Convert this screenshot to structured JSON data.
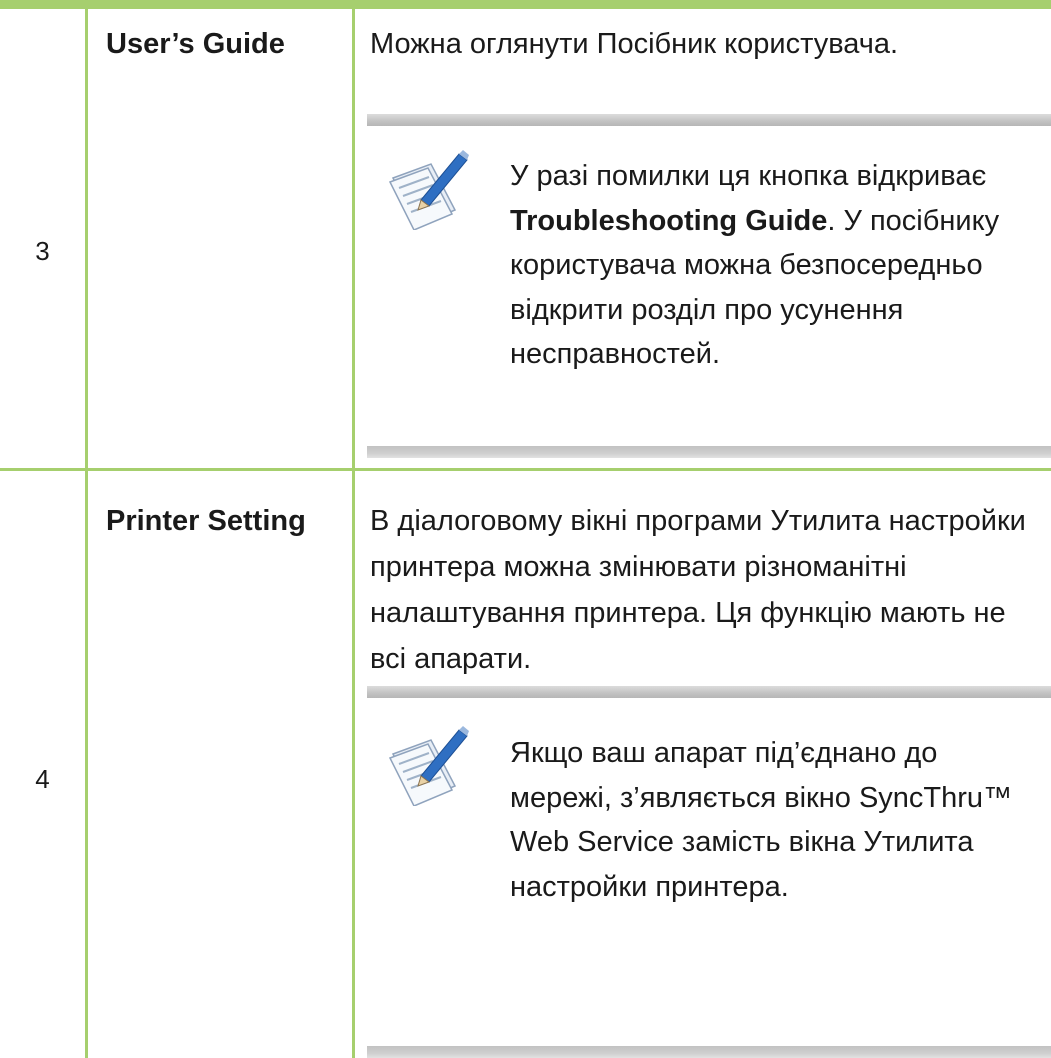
{
  "table": {
    "rows": [
      {
        "number": "3",
        "name": "User’s Guide",
        "description": "Можна оглянути Посібник користувача.",
        "note": {
          "icon": "note-pencil-icon",
          "text_pre": "У разі помилки ця кнопка відкриває ",
          "text_bold_1": "Troubleshooting Guide",
          "text_post": ". У посібнику користувача можна безпосередньо відкрити розділ про усунення несправностей."
        }
      },
      {
        "number": "4",
        "name": "Printer Setting",
        "description": "В діалоговому вікні програми Утилита настройки принтера можна змінювати різноманітні налаштування принтера. Ця функцію мають не всі апарати.",
        "note": {
          "icon": "note-pencil-icon",
          "text": "Якщо ваш апарат під’єднано до мережі, з’являється вікно SyncThru™ Web Service замість вікна Утилита настройки принтера."
        }
      }
    ]
  },
  "colors": {
    "border": "#a6cf6e",
    "note_bar": "#c2c2c2"
  }
}
